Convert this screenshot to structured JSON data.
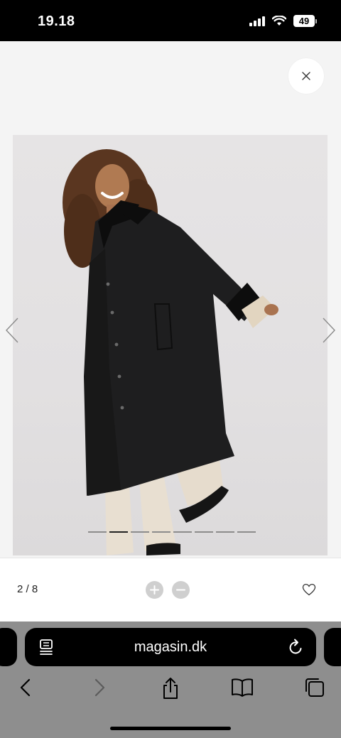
{
  "status": {
    "time": "19.18",
    "battery": "49"
  },
  "viewer": {
    "close_icon": "close-icon",
    "prev_icon": "chevron-left-icon",
    "next_icon": "chevron-right-icon",
    "slide_count": 8,
    "active_slide": 2
  },
  "toolbar": {
    "counter": "2 / 8",
    "zoom_in_icon": "plus-icon",
    "zoom_out_icon": "minus-icon",
    "favorite_icon": "heart-icon"
  },
  "browser": {
    "url": "magasin.dk",
    "icons": [
      "reader-icon",
      "reload-icon",
      "back-icon",
      "forward-icon",
      "share-icon",
      "bookmarks-icon",
      "tabs-icon"
    ]
  },
  "colors": {
    "viewer_bg": "#f4f4f4",
    "safari_bar": "#8e8e8e",
    "coat": "#1e1e1f"
  }
}
